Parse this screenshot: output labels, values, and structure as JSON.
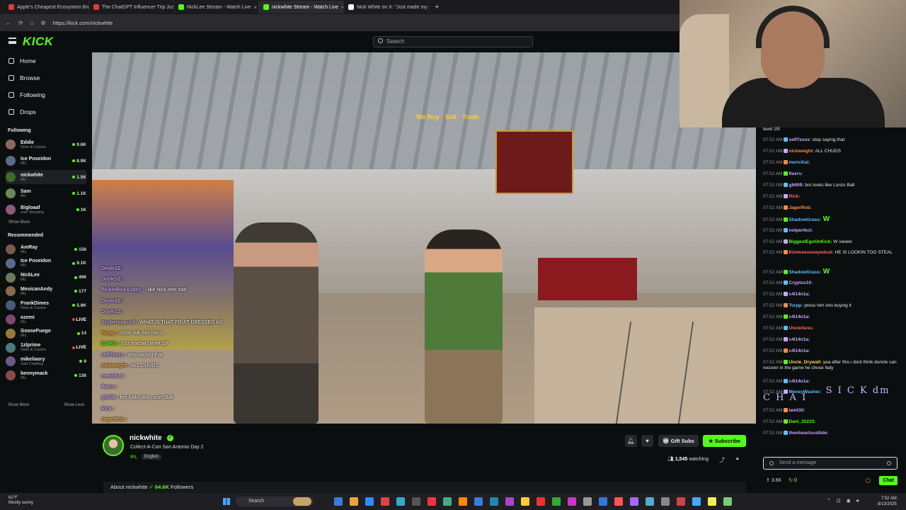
{
  "browser": {
    "tabs": [
      {
        "title": "Apple's Cheapest Ecosystem Bndl",
        "color": "#e03b3b",
        "active": false
      },
      {
        "title": "The ChatGPT Influencer Trip Just",
        "color": "#e03b3b",
        "active": false
      },
      {
        "title": "NickLee Stream - Watch Live",
        "color": "#53fc18",
        "active": false
      },
      {
        "title": "nickwhite Stream - Watch Live",
        "color": "#53fc18",
        "active": true
      },
      {
        "title": "Nick White on X: \"Just made my fi",
        "color": "#ffffff",
        "active": false
      }
    ],
    "url": "https://kick.com/nickwhite"
  },
  "header": {
    "logo": "KICK",
    "search_placeholder": "Search"
  },
  "sidebar": {
    "nav": [
      {
        "label": "Home"
      },
      {
        "label": "Browse"
      },
      {
        "label": "Following"
      },
      {
        "label": "Drops"
      }
    ],
    "following_title": "Following",
    "following": [
      {
        "name": "Eddie",
        "category": "Slots & Casino",
        "viewers": "9.6K",
        "color": "#8a6a5a"
      },
      {
        "name": "Ice Poseidon",
        "category": "IRL",
        "viewers": "8.9K",
        "color": "#5a6a8a"
      },
      {
        "name": "nickwhite",
        "category": "IRL",
        "viewers": "1.5K",
        "color": "#3a6d2a"
      },
      {
        "name": "Sam",
        "category": "IRL",
        "viewers": "1.1K",
        "color": "#6a8a5a"
      },
      {
        "name": "Bigloaaf",
        "category": "Just Sleeping",
        "viewers": "1K",
        "color": "#8a5a7a"
      }
    ],
    "show_more_1": "Show More",
    "recommended_title": "Recommended",
    "recommended": [
      {
        "name": "AmRay",
        "category": "IRL",
        "viewers": "156",
        "color": "#7a5a4a"
      },
      {
        "name": "Ice Poseidon",
        "category": "IRL",
        "viewers": "9.1K",
        "color": "#5a6a8a"
      },
      {
        "name": "NickLee",
        "category": "IRL",
        "viewers": "496",
        "color": "#6a7a5a"
      },
      {
        "name": "MexicanAndy",
        "category": "IRL",
        "viewers": "177",
        "color": "#8a6a4a"
      },
      {
        "name": "FrankDimes",
        "category": "Slots & Casino",
        "viewers": "5.9K",
        "color": "#4a5a7a"
      },
      {
        "name": "ozemi",
        "category": "IRL",
        "viewers": "LIVE",
        "color": "#7a4a6a"
      },
      {
        "name": "GooseFuego",
        "category": "IRL",
        "viewers": "14",
        "color": "#9a7a3a"
      },
      {
        "name": "1zlprime",
        "category": "Slots & Casino",
        "viewers": "LIVE",
        "color": "#4a7a7a"
      },
      {
        "name": "mikeliaory",
        "category": "Just Chatting",
        "viewers": "9",
        "color": "#6a5a8a"
      },
      {
        "name": "bennymack",
        "category": "IRL",
        "viewers": "136",
        "color": "#8a4a4a"
      }
    ],
    "show_more_2": "Show More",
    "show_less": "Show Less"
  },
  "video": {
    "banner_text": "We Buy · Sell · Trade",
    "overlay_chat": [
      {
        "user": "Doyle32 :",
        "text": "",
        "color": "u"
      },
      {
        "user": "Doyle32 :",
        "text": "",
        "color": "u"
      },
      {
        "user": "PickleRickAstley :",
        "text": "i like Nick lees hair",
        "color": "u"
      },
      {
        "user": "Doyle32 :",
        "text": "",
        "color": "u"
      },
      {
        "user": "Doyle32 :",
        "text": "",
        "color": "u"
      },
      {
        "user": "XcyberspaceX :",
        "text": "WHAT IS THAT FRUIT DRESSED AS",
        "color": "u"
      },
      {
        "user": "Turpp :",
        "text": "cmon talk him into it",
        "color": "o"
      },
      {
        "user": "BotRix :",
        "text": "just reached level 19!",
        "color": "g"
      },
      {
        "user": "self7esss :",
        "text": "stop saying that",
        "color": "u"
      },
      {
        "user": "nickweight :",
        "text": "ALL CHUDS",
        "color": "o"
      },
      {
        "user": "mericKat :",
        "text": "",
        "color": "u"
      },
      {
        "user": "flaxrs :",
        "text": "",
        "color": "u"
      },
      {
        "user": "gb909 :",
        "text": "bro looks like Lonzo Ball",
        "color": "u"
      },
      {
        "user": "Rick :",
        "text": "",
        "color": "u"
      },
      {
        "user": "JagerRob :",
        "text": "",
        "color": "o"
      }
    ]
  },
  "chat": {
    "messages": [
      {
        "time": "",
        "user": "",
        "text": "level 19!",
        "uc": "u1"
      },
      {
        "time": "07:52 AM",
        "user": "self7esss:",
        "text": "stop saying that",
        "uc": "u1"
      },
      {
        "time": "07:52 AM",
        "user": "nickweight:",
        "text": "ALL CHUDS",
        "uc": "u3"
      },
      {
        "time": "07:52 AM",
        "user": "mericKat:",
        "text": "",
        "uc": "u4"
      },
      {
        "time": "07:52 AM",
        "user": "flaxrs:",
        "text": "",
        "uc": "u1"
      },
      {
        "time": "07:52 AM",
        "user": "gb909:",
        "text": "bro looks like Lonzo Ball",
        "uc": "u1"
      },
      {
        "time": "07:52 AM",
        "user": "Rick:",
        "text": "",
        "uc": "u5"
      },
      {
        "time": "07:52 AM",
        "user": "JagerRob:",
        "text": "",
        "uc": "u3"
      },
      {
        "time": "07:52 AM",
        "user": "ShadowGrass:",
        "text": "W",
        "uc": "u4"
      },
      {
        "time": "07:52 AM",
        "user": "notperfect:",
        "text": "",
        "uc": "u1"
      },
      {
        "time": "07:52 AM",
        "user": "BiggestEgoOnKick:",
        "text": "W viewer",
        "uc": "u2"
      },
      {
        "time": "07:52 AM",
        "user": "Kimmeesoneyedcat:",
        "text": "HE IS LOOKIN TOO STEAL",
        "uc": "u5"
      },
      {
        "time": "07:52 AM",
        "user": "ShadowGrass:",
        "text": "W",
        "uc": "u4"
      },
      {
        "time": "07:52 AM",
        "user": "Cryptoz10:",
        "text": "",
        "uc": "u1"
      },
      {
        "time": "07:52 AM",
        "user": "c4l14n1a:",
        "text": "",
        "uc": "u1"
      },
      {
        "time": "07:52 AM",
        "user": "Turpp:",
        "text": "press him into buying it",
        "uc": "u4"
      },
      {
        "time": "07:52 AM",
        "user": "c4l14n1a:",
        "text": "",
        "uc": "u1"
      },
      {
        "time": "07:52 AM",
        "user": "UncleSess:",
        "text": "",
        "uc": "u5"
      },
      {
        "time": "07:52 AM",
        "user": "c4l14n1a:",
        "text": "",
        "uc": "u1"
      },
      {
        "time": "07:52 AM",
        "user": "c4l14n1a:",
        "text": "",
        "uc": "u1"
      },
      {
        "time": "07:52 AM",
        "user": "Uncle_Drywall:",
        "text": "yea after this i dont think duncle can recover in the game he chose Italy",
        "uc": "u6"
      },
      {
        "time": "07:52 AM",
        "user": "c4l14n1a:",
        "text": "",
        "uc": "u1"
      },
      {
        "time": "07:52 AM",
        "user": "MoneyWasher:",
        "text": "S I C K dm C H A I",
        "uc": "u4"
      },
      {
        "time": "07:52 AM",
        "user": "lamt30:",
        "text": "",
        "uc": "u1"
      },
      {
        "time": "07:52 AM",
        "user": "Dani_20233:",
        "text": "",
        "uc": "u2"
      },
      {
        "time": "07:52 AM",
        "user": "thenheartscollide:",
        "text": "",
        "uc": "u1"
      }
    ],
    "input_placeholder": "Send a message",
    "stat_likes": "3.6K",
    "stat_count": "0",
    "chat_button": "Chat"
  },
  "channel": {
    "name": "nickwhite",
    "title": "Collect-A-Con San Antonio Day 2",
    "category": "IRL",
    "language": "English",
    "gift_subs": "Gift Subs",
    "subscribe": "Subscribe",
    "watching_count": "1,545",
    "watching_label": "watching",
    "about_label": "About nickwhite",
    "followers_count": "64.6K",
    "followers_label": "Followers"
  },
  "taskbar": {
    "weather_temp": "62°F",
    "weather_desc": "Mostly sunny",
    "search": "Search",
    "time": "7:52 AM",
    "date": "8/13/2025"
  }
}
